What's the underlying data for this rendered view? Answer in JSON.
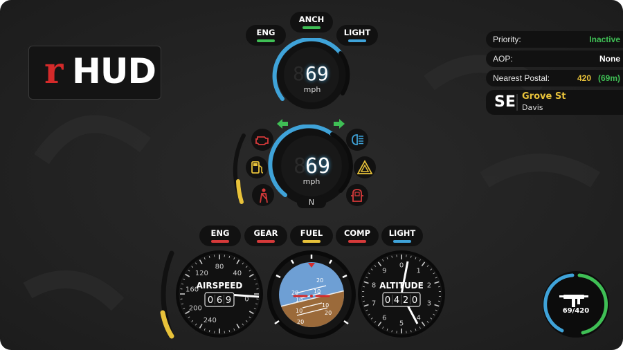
{
  "logo": {
    "r": "r",
    "text": "HUD"
  },
  "top_indicators": [
    {
      "label": "ANCH",
      "color": "#3fbf55"
    },
    {
      "label": "ENG",
      "color": "#3fbf55"
    },
    {
      "label": "LIGHT",
      "color": "#3fa3d9"
    }
  ],
  "speedo_top": {
    "ghost": "8",
    "speed": "69",
    "unit": "mph",
    "level": 0.6
  },
  "speedo_mid": {
    "ghost": "8",
    "speed": "69",
    "unit": "mph",
    "gear": "N",
    "level": 0.6,
    "fuel_level": 0.3
  },
  "status_icons": {
    "left": [
      "check-engine-icon",
      "fuel-pump-icon",
      "seatbelt-icon"
    ],
    "right": [
      "headlight-icon",
      "hazard-icon",
      "door-open-icon"
    ],
    "arrows": [
      "turn-left-icon",
      "turn-right-icon"
    ]
  },
  "info": {
    "priority_label": "Priority:",
    "priority_value": "Inactive",
    "priority_color": "#3fbf55",
    "aop_label": "AOP:",
    "aop_value": "None",
    "postal_label": "Nearest Postal:",
    "postal_value": "420",
    "postal_dist": "(69m)",
    "compass": "SE",
    "street": "Grove St",
    "area": "Davis"
  },
  "aircraft_indicators": [
    {
      "label": "ENG",
      "color": "#d63a3a"
    },
    {
      "label": "GEAR",
      "color": "#d63a3a"
    },
    {
      "label": "FUEL",
      "color": "#e8c23a"
    },
    {
      "label": "COMP",
      "color": "#d63a3a"
    },
    {
      "label": "LIGHT",
      "color": "#3fa3d9"
    }
  ],
  "airspeed": {
    "title": "AIRSPEED",
    "digits": [
      "0",
      "6",
      "9"
    ],
    "ticks": [
      "0",
      "40",
      "80",
      "120",
      "160",
      "200",
      "240"
    ],
    "throttle_level": 0.3
  },
  "horizon": {
    "pitch_labels": [
      "20",
      "20",
      "10",
      "10",
      "10",
      "10",
      "20",
      "20"
    ]
  },
  "altitude": {
    "title": "ALTITUDE",
    "digits": [
      "0",
      "4",
      "2",
      "0"
    ],
    "ticks": [
      "0",
      "1",
      "2",
      "3",
      "4",
      "5",
      "6",
      "7",
      "8",
      "9"
    ]
  },
  "weapon": {
    "ammo": "69/420",
    "icon": "smg-icon"
  }
}
